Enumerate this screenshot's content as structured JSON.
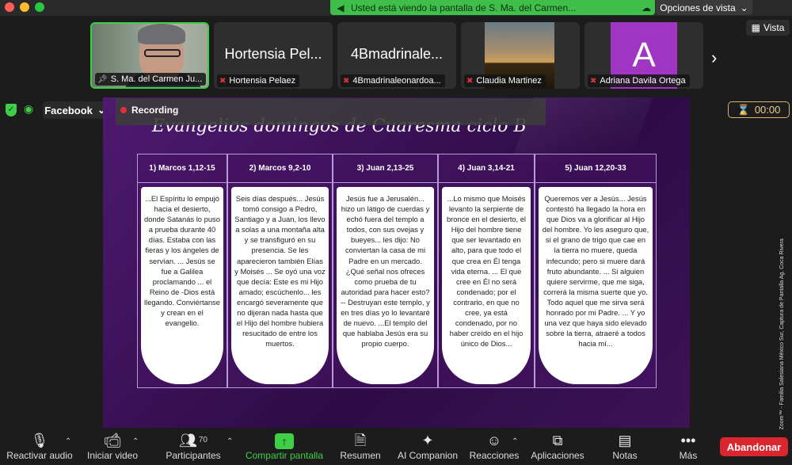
{
  "banner": {
    "text": "Usted está viendo la pantalla de S. Ma. del Carmen...",
    "view_options": "Opciones de vista"
  },
  "gallery": {
    "view_label": "Vista",
    "tiles": [
      {
        "big": "",
        "label": "S. Ma. del Carmen Ju..."
      },
      {
        "big": "Hortensia Pel...",
        "label": "Hortensia Pelaez"
      },
      {
        "big": "4Bmadrinale...",
        "label": "4Bmadrinaleonardoa..."
      },
      {
        "big": "",
        "label": "Claudia Martinez"
      },
      {
        "big": "A",
        "label": "Adriana Davila Ortega"
      }
    ]
  },
  "toolbar2": {
    "stream": "Facebook",
    "recording": "Recording",
    "timer": "00:00"
  },
  "slide": {
    "title": "Evangelios domingos de Cuaresma ciclo B",
    "columns": [
      {
        "head": "1) Marcos 1,12-15",
        "body": "...El Espíritu lo empujó hacia el desierto, donde Satanás lo puso a prueba durante 40 días. Estaba con las fieras y los ángeles de servían. ... Jesús se fue a Galilea proclamando ... el Reino de -Dios está llegando. Conviértanse y crean en el evangelio."
      },
      {
        "head": "2)  Marcos 9,2-10",
        "body": "Seis días después... Jesús tomó consigo a Pedro, Santiago y a Juan, los llevo a solas a una montaña alta y se transfiguró en su presencia. Se les aparecieron también Elías y Moisés ... Se oyó una voz que decía: Este es mi Hijo amado; escúchenlo... les encargó severamente que no dijeran nada hasta que el Hijo del hombre hubiera resucitado de entre los muertos."
      },
      {
        "head": "3) Juan 2,13-25",
        "body": "Jesús fue a Jerusalén... hizo un látigo de cuerdas y echó fuera del templo a todos, con sus ovejas y bueyes... les dijo: No conviertan la casa de mi Padre en un mercado. ¿Qué señal nos ofreces como prueba de tu autoridad para hacer esto? -- Destruyan este templo, y en tres días yo lo levantaré de nuevo. ...El templo del que hablaba Jesús era su propio cuerpo."
      },
      {
        "head": "4)  Juan 3,14-21",
        "body": "...Lo mismo que Moisés levanto la serpiente de bronce en el desierto, el Hijo del hombre tiene que ser levantado en alto, para que todo el que crea en Él tenga vida eterna. ... El que cree en Él no será condenado; por el contrario, en que no cree, ya está condenado, por no haber creído en el hijo único de Dios..."
      },
      {
        "head": "5) Juan 12,20-33",
        "body": "Queremos ver a Jesús... Jesús contestó ha llegado la hora en que Dios va a glorificar al Hijo del hombre. Yo les aseguro que, si el grano de trigo que cae en la tierra no muere, queda infecundo; pero si muere dará fruto abundante. ... Si alguien quiere servirme, que me siga, correrá la misma suerte que yo. Todo aquel que me sirva será honrado por mi Padre. ... Y yo una vez que haya sido elevado sobre la tierra, atraeré a todos hacia mí..."
      }
    ]
  },
  "watermark": "Cortesía © Zoom™ - Familia Salesiana México Sur, Captura de Pantalla Ag. Coca Rivera",
  "bottom": {
    "audio": "Reactivar audio",
    "video": "Iniciar video",
    "participants": "Participantes",
    "participants_count": "70",
    "share": "Compartir pantalla",
    "summary": "Resumen",
    "ai": "AI Companion",
    "reactions": "Reacciones",
    "apps": "Aplicaciones",
    "notes": "Notas",
    "more": "Más",
    "leave": "Abandonar"
  }
}
